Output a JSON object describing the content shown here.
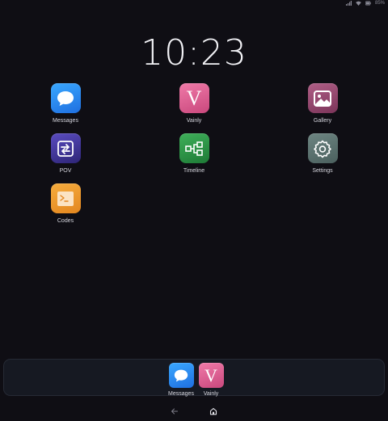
{
  "status": {
    "battery_text": "85%",
    "icons": [
      "signal-icon",
      "wifi-icon",
      "battery-icon"
    ]
  },
  "clock": {
    "time": "10:23"
  },
  "apps": [
    {
      "label": "Messages",
      "icon": "chat-bubble-icon",
      "color": "#2b8cf2"
    },
    {
      "label": "Vainly",
      "icon": "letter-v-icon",
      "color": "#e0608f"
    },
    {
      "label": "Gallery",
      "icon": "image-icon",
      "color": "#96496f"
    },
    {
      "label": "POV",
      "icon": "swap-arrows-icon",
      "color": "#3f3596"
    },
    {
      "label": "Timeline",
      "icon": "flow-diagram-icon",
      "color": "#2f9447"
    },
    {
      "label": "Settings",
      "icon": "gear-icon",
      "color": "#5d7371"
    },
    {
      "label": "Codes",
      "icon": "terminal-icon",
      "color": "#ee9a2e"
    }
  ],
  "dock": {
    "apps": [
      {
        "label": "Messages",
        "icon": "chat-bubble-icon"
      },
      {
        "label": "Vainly",
        "icon": "letter-v-icon"
      }
    ]
  },
  "nav": {
    "back": "back-arrow-icon",
    "home": "home-icon"
  }
}
